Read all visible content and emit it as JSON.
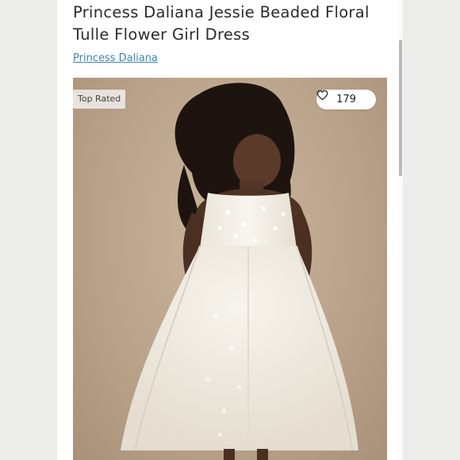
{
  "listing": {
    "title": "Princess Daliana Jessie Beaded Floral Tulle Flower Girl Dress",
    "brand": "Princess Daliana",
    "badge": "Top Rated",
    "likes_count": "179"
  },
  "icons": {
    "like": "heart-outline-icon"
  },
  "colors": {
    "brand_link": "#3d86ad",
    "photo_background": "#bea78f",
    "dress": "#f3efe6"
  }
}
